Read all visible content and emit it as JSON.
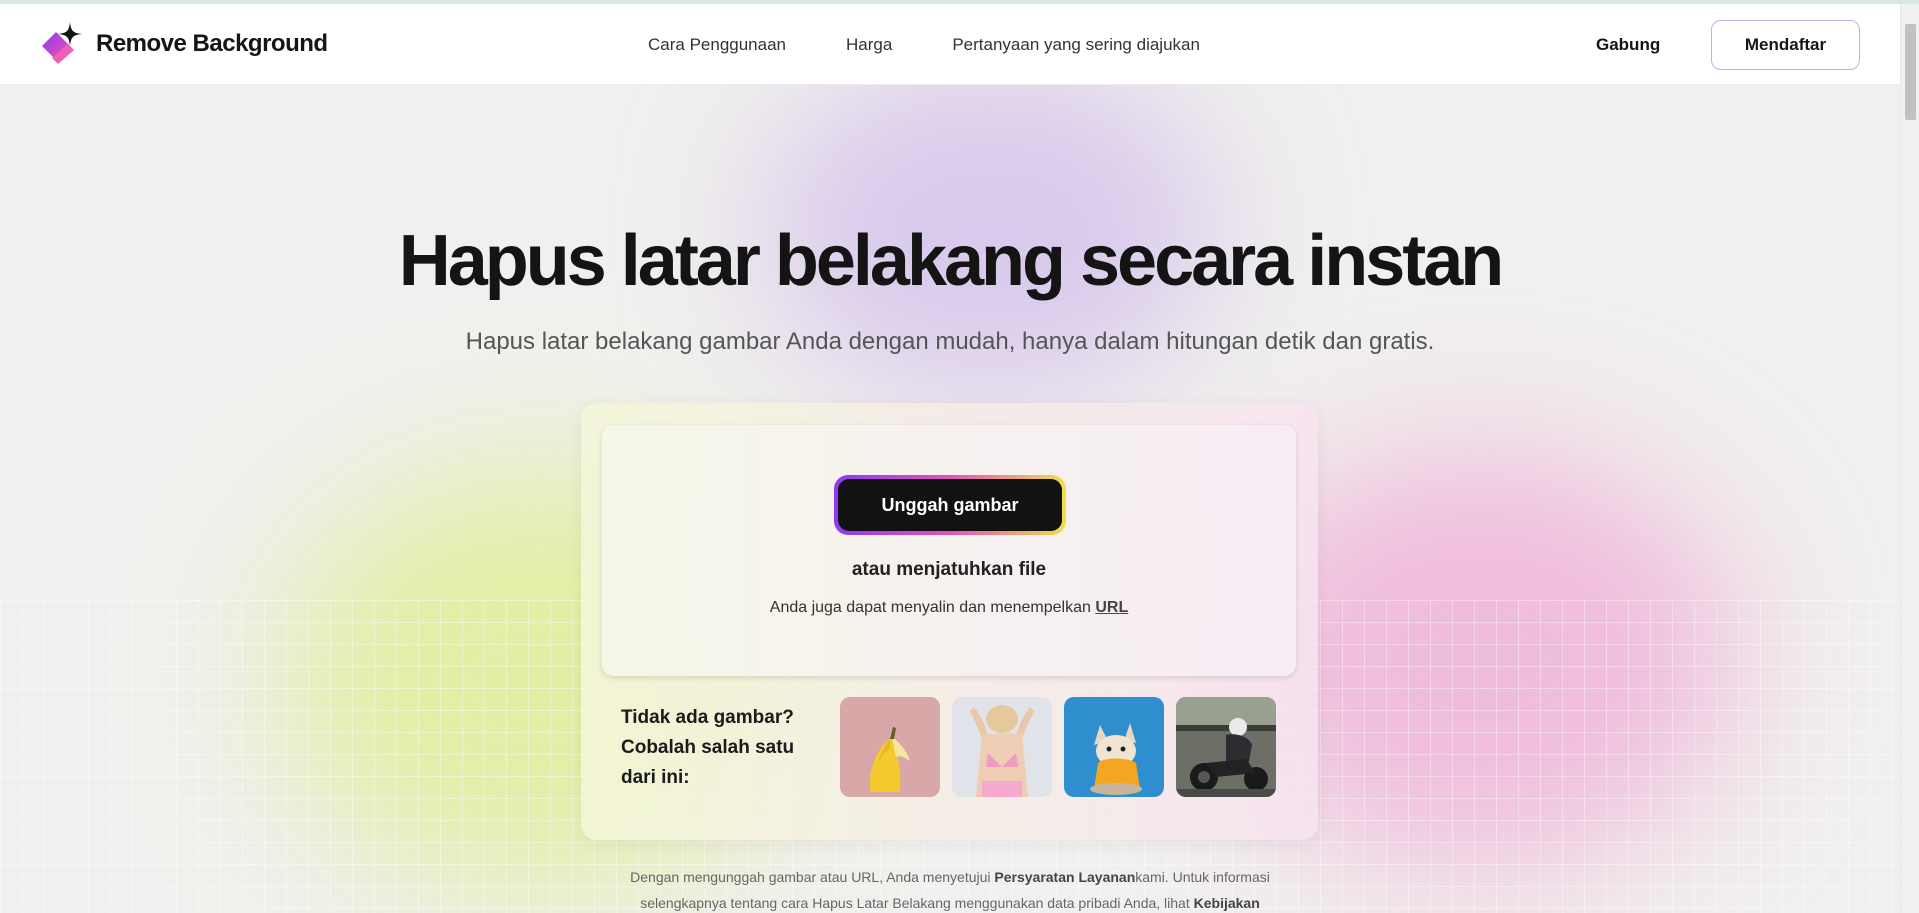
{
  "header": {
    "brand": "Remove Background",
    "nav": [
      {
        "label": "Cara Penggunaan"
      },
      {
        "label": "Harga"
      },
      {
        "label": "Pertanyaan yang sering diajukan"
      }
    ],
    "login_label": "Gabung",
    "signup_label": "Mendaftar"
  },
  "hero": {
    "title": "Hapus latar belakang secara instan",
    "subtitle": "Hapus latar belakang gambar Anda dengan mudah, hanya dalam hitungan detik dan gratis."
  },
  "upload": {
    "button_label": "Unggah gambar",
    "drop_text": "atau menjatuhkan file",
    "paste_text": "Anda juga dapat menyalin dan menempelkan",
    "url_link": "URL"
  },
  "samples": {
    "label": "Tidak ada gambar? Cobalah salah satu dari ini:",
    "items": [
      {
        "icon": "banana-image"
      },
      {
        "icon": "woman-back-image"
      },
      {
        "icon": "dog-image"
      },
      {
        "icon": "motorcycle-image"
      }
    ]
  },
  "disclaimer": {
    "part1": "Dengan mengunggah gambar atau URL, Anda menyetujui ",
    "terms_link": "Persyaratan Layanan",
    "part2": "kami. Untuk informasi selengkapnya tentang cara Hapus Latar Belakang menggunakan data pribadi Anda, lihat ",
    "policy_link": "Kebijakan"
  },
  "colors": {
    "accent_purple": "#8b3cf0",
    "accent_pink": "#e452b9",
    "accent_yellow": "#efe04a",
    "button_dark": "#121212"
  }
}
